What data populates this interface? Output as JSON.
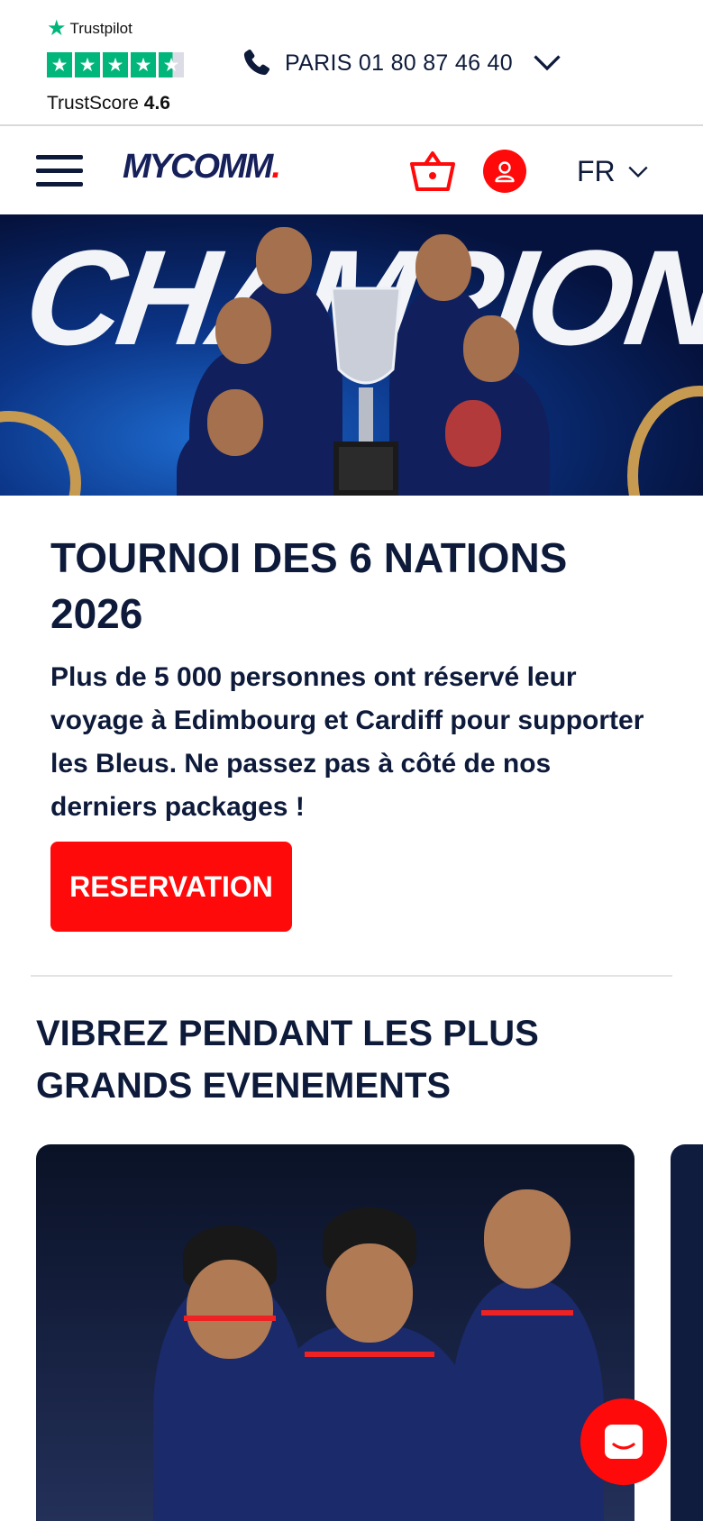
{
  "trustpilot": {
    "brand": "Trustpilot",
    "score_label": "TrustScore",
    "score_value": "4.6",
    "rating": 4.5,
    "rating_max": 5
  },
  "header": {
    "phone_label": "PARIS 01 80 87 46 40"
  },
  "nav": {
    "logo_text": "MYCOMM",
    "logo_dot": ".",
    "language": "FR"
  },
  "hero": {
    "banner_text": "CHAMPIONS"
  },
  "intro": {
    "title": "TOURNOI DES 6 NATIONS 2026",
    "text": "Plus de 5 000 personnes ont réservé leur voyage à Edimbourg et Cardiff pour supporter les Bleus. Ne passez pas à côté de nos derniers packages !",
    "cta_label": "RESERVATION"
  },
  "events": {
    "title": "VIBREZ PENDANT LES PLUS GRANDS EVENEMENTS"
  },
  "colors": {
    "accent": "#ff0a0a",
    "navy": "#0d1a3a",
    "trustpilot_green": "#00b67a"
  },
  "icons": {
    "phone": "phone-icon",
    "chevron": "chevron-down-icon",
    "menu": "hamburger-menu-icon",
    "cart": "basket-icon",
    "account": "user-icon",
    "chat": "chat-icon",
    "trustpilot": "star-icon"
  }
}
